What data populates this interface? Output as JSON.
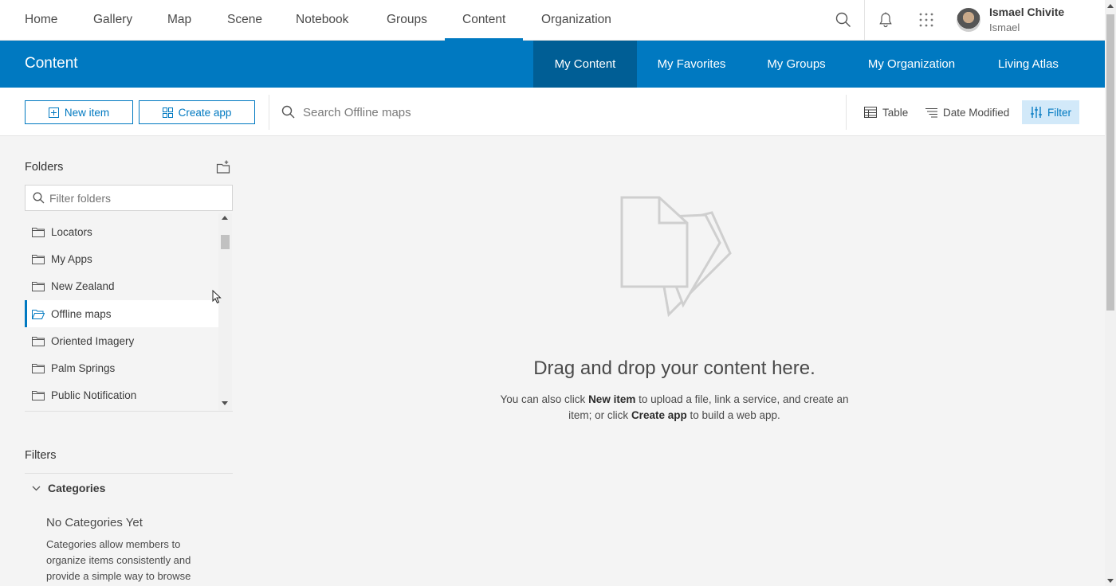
{
  "topnav": {
    "links": [
      "Home",
      "Gallery",
      "Map",
      "Scene",
      "Notebook",
      "Groups",
      "Content",
      "Organization"
    ],
    "active": "Content",
    "user": {
      "name": "Ismael Chivite",
      "username": "Ismael"
    }
  },
  "header": {
    "title": "Content",
    "tabs": [
      "My Content",
      "My Favorites",
      "My Groups",
      "My Organization",
      "Living Atlas"
    ],
    "active_tab": "My Content"
  },
  "toolbar": {
    "new_item": "New item",
    "create_app": "Create app",
    "search_placeholder": "Search Offline maps",
    "table": "Table",
    "sort": "Date Modified",
    "filter": "Filter"
  },
  "sidebar": {
    "folders_title": "Folders",
    "filter_placeholder": "Filter folders",
    "folders": [
      "Locators",
      "My Apps",
      "New Zealand",
      "Offline maps",
      "Oriented Imagery",
      "Palm Springs",
      "Public Notification"
    ],
    "selected_folder": "Offline maps",
    "filters_title": "Filters",
    "categories_label": "Categories",
    "no_categories_title": "No Categories Yet",
    "no_categories_desc": "Categories allow members to organize items consistently and provide a simple way to browse"
  },
  "empty_state": {
    "title": "Drag and drop your content here.",
    "desc_prefix": "You can also click ",
    "desc_bold1": "New item",
    "desc_mid": " to upload a file, link a service, and create an item; or click ",
    "desc_bold2": "Create app",
    "desc_suffix": " to build a web app."
  },
  "colors": {
    "accent": "#0079c1",
    "accent_dark": "#005e95",
    "filter_bg": "#d2e9f9"
  },
  "icons": [
    "search-icon",
    "bell-icon",
    "apps-grid-icon",
    "plus-square-icon",
    "grid-icon",
    "table-icon",
    "sort-icon",
    "filter-icon",
    "new-folder-icon",
    "folder-icon",
    "folder-open-icon",
    "chevron-down-icon",
    "documents-icon"
  ]
}
